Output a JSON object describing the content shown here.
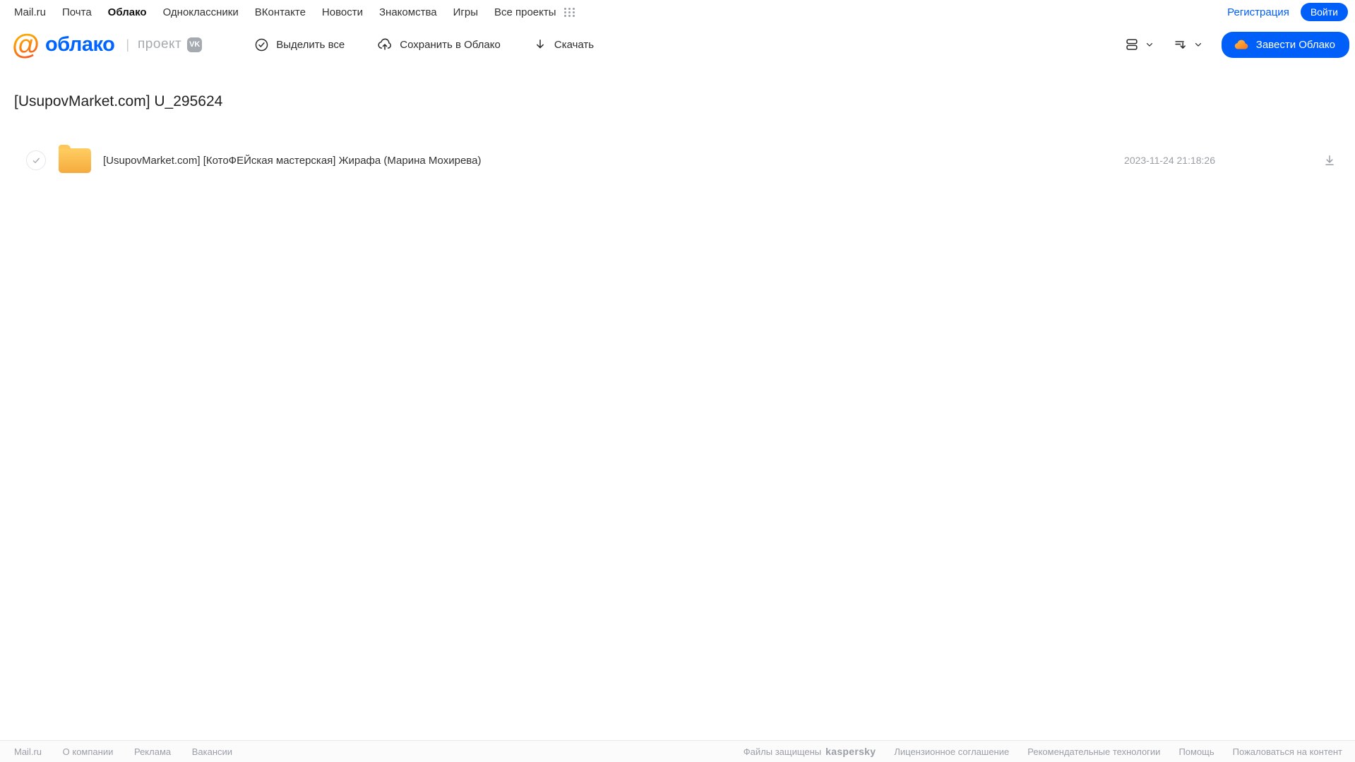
{
  "topnav": {
    "items": [
      "Mail.ru",
      "Почта",
      "Облако",
      "Одноклассники",
      "ВКонтакте",
      "Новости",
      "Знакомства",
      "Игры",
      "Все проекты"
    ],
    "active_item": "Облако",
    "registration_label": "Регистрация",
    "login_label": "Войти"
  },
  "header": {
    "logo_at": "@",
    "logo_text": "облако",
    "logo_divider": "|",
    "project_label": "проект",
    "vk_badge": "vk",
    "actions": {
      "select_all": "Выделить все",
      "save_to_cloud": "Сохранить в Облако",
      "download": "Скачать"
    },
    "get_cloud_button": "Завести Облако"
  },
  "main": {
    "title": "[UsupovMarket.com] U_295624",
    "files": [
      {
        "type": "folder",
        "name": "[UsupovMarket.com] [КотоФЕЙская мастерская] Жирафа (Марина Мохирева)",
        "date": "2023-11-24 21:18:26"
      }
    ]
  },
  "footer": {
    "left_links": [
      "Mail.ru",
      "О компании",
      "Реклама",
      "Вакансии"
    ],
    "protected_label": "Файлы защищены",
    "kaspersky_label": "kaspersky",
    "right_links": [
      "Лицензионное соглашение",
      "Рекомендательные технологии",
      "Помощь",
      "Пожаловаться на контент"
    ]
  },
  "icons": {
    "apps_grid": "grid-of-dots",
    "select_all": "check-in-circle",
    "save_to_cloud": "cloud-with-up-arrow",
    "download_toolbar": "arrow-down",
    "view_mode": "stacked-rows",
    "sort": "lines-with-down-arrow",
    "chevron": "chevron-down",
    "cloud_brand": "orange-cloud",
    "file_download": "arrow-down-with-bar",
    "row_check": "checkmark"
  },
  "colors": {
    "accent_blue": "#005ff9",
    "logo_blue": "#0065ff",
    "logo_orange": "#ff9500",
    "folder_yellow": "#f9bc4c",
    "kaspersky_green": "#00a88e",
    "muted_grey": "#9a9ea6",
    "text_dark": "#2c2d2e"
  }
}
